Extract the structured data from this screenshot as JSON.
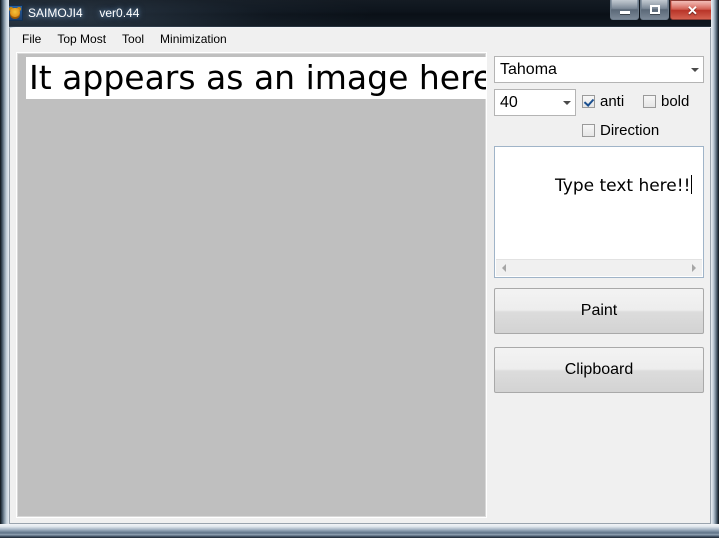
{
  "window": {
    "title": "SAIMOJI4     ver0.44",
    "app_icon": "bear-icon",
    "controls": {
      "minimize": "minimize-icon",
      "maximize": "maximize-icon",
      "close": "✕"
    }
  },
  "menu": {
    "items": [
      {
        "label": "File"
      },
      {
        "label": "Top Most"
      },
      {
        "label": "Tool"
      },
      {
        "label": "Minimization"
      }
    ]
  },
  "preview": {
    "rendered_text": "It appears as an image here!!",
    "canvas_color": "#bfbfbf",
    "text_background": "#ffffff"
  },
  "controls": {
    "font": {
      "selected": "Tahoma",
      "arrow_icon": "chevron-down-icon"
    },
    "size": {
      "selected": "40",
      "arrow_icon": "chevron-down-icon"
    },
    "checkboxes": [
      {
        "id": "anti",
        "label": "anti",
        "checked": true
      },
      {
        "id": "bold",
        "label": "bold",
        "checked": false
      },
      {
        "id": "direction",
        "label": "Direction",
        "checked": false
      }
    ],
    "text_input": {
      "value": "Type text here!!",
      "scrollbar_left_icon": "triangle-left-icon",
      "scrollbar_right_icon": "triangle-right-icon"
    },
    "buttons": {
      "paint": "Paint",
      "clipboard": "Clipboard"
    }
  }
}
